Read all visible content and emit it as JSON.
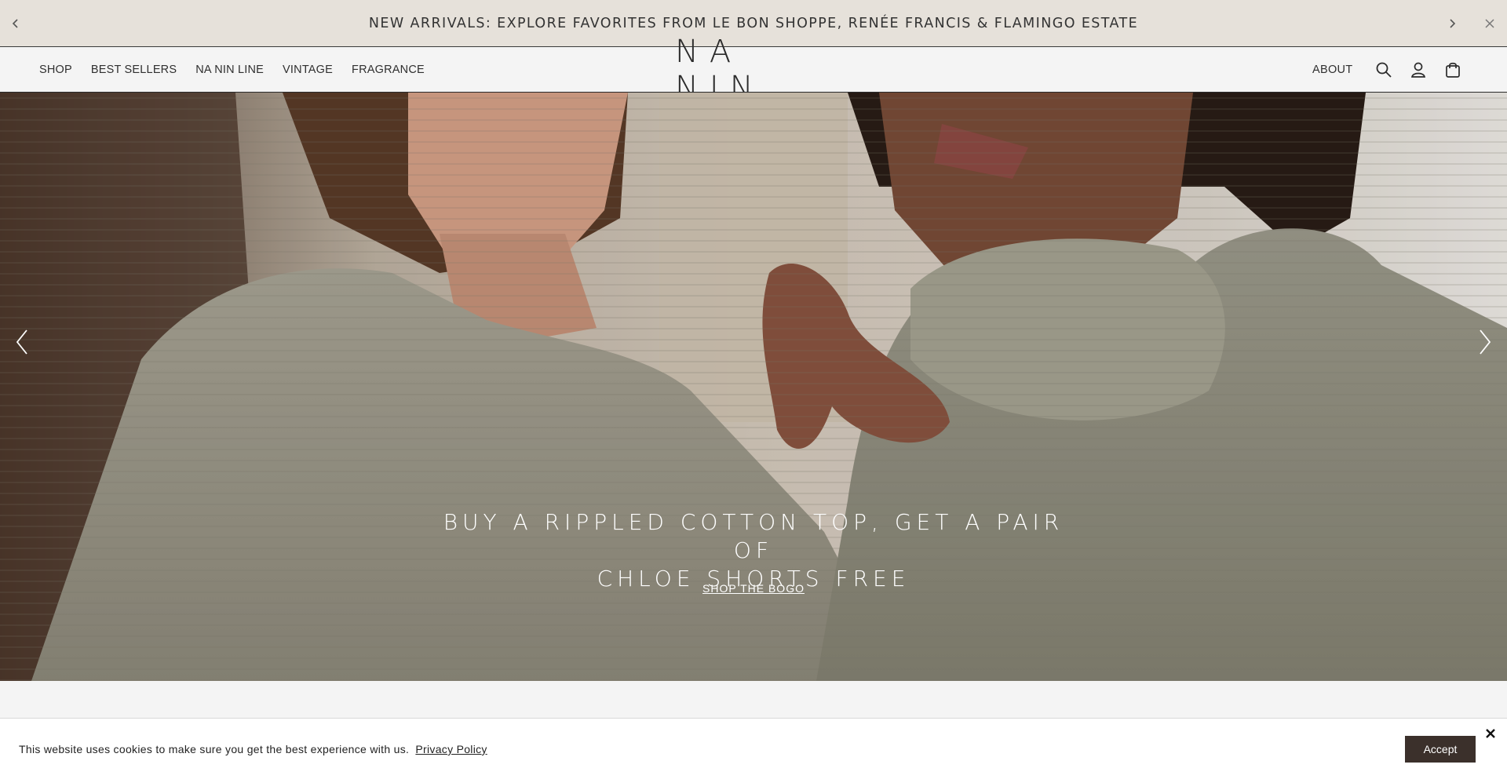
{
  "announcement": {
    "text": "NEW ARRIVALS: EXPLORE FAVORITES FROM LE BON SHOPPE, RENÉE FRANCIS & FLAMINGO ESTATE",
    "background": "#e6e1da"
  },
  "header": {
    "nav": [
      {
        "label": "SHOP"
      },
      {
        "label": "BEST SELLERS"
      },
      {
        "label": "NA NIN LINE"
      },
      {
        "label": "VINTAGE"
      },
      {
        "label": "FRAGRANCE"
      }
    ],
    "logo": "NA NIN",
    "about_label": "ABOUT",
    "icons": [
      "search-icon",
      "account-icon",
      "cart-icon"
    ]
  },
  "hero": {
    "title_line1": "BUY A RIPPLED COTTON TOP, GET A PAIR OF",
    "title_line2": "CHLOE SHORTS FREE",
    "cta_label": "SHOP THE BOGO"
  },
  "cookie": {
    "text": "This website uses cookies to make sure you get the best experience with us.",
    "link_label": "Privacy Policy",
    "accept_label": "Accept",
    "accept_color": "#3b302b"
  }
}
